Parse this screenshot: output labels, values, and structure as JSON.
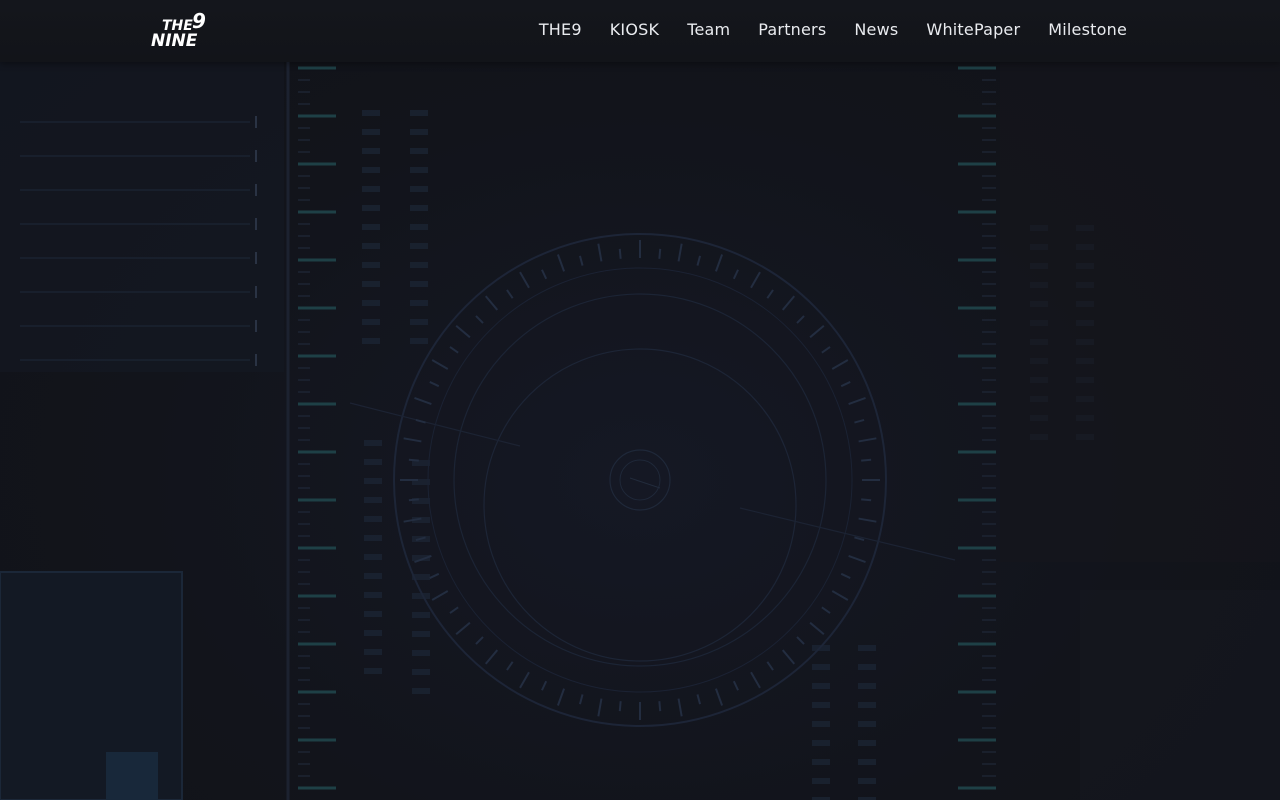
{
  "logo": {
    "line1": "THE",
    "digit": "9",
    "line2": "NINE"
  },
  "nav": {
    "items": [
      {
        "label": "THE9"
      },
      {
        "label": "KIOSK"
      },
      {
        "label": "Team"
      },
      {
        "label": "Partners"
      },
      {
        "label": "News"
      },
      {
        "label": "WhitePaper"
      },
      {
        "label": "Milestone"
      }
    ]
  },
  "colors": {
    "background": "#12141a",
    "navbar": "#14161c",
    "nav_text": "#e9ebef",
    "hud_line": "#1f2a3a",
    "hud_accent": "#1e4d4a"
  }
}
